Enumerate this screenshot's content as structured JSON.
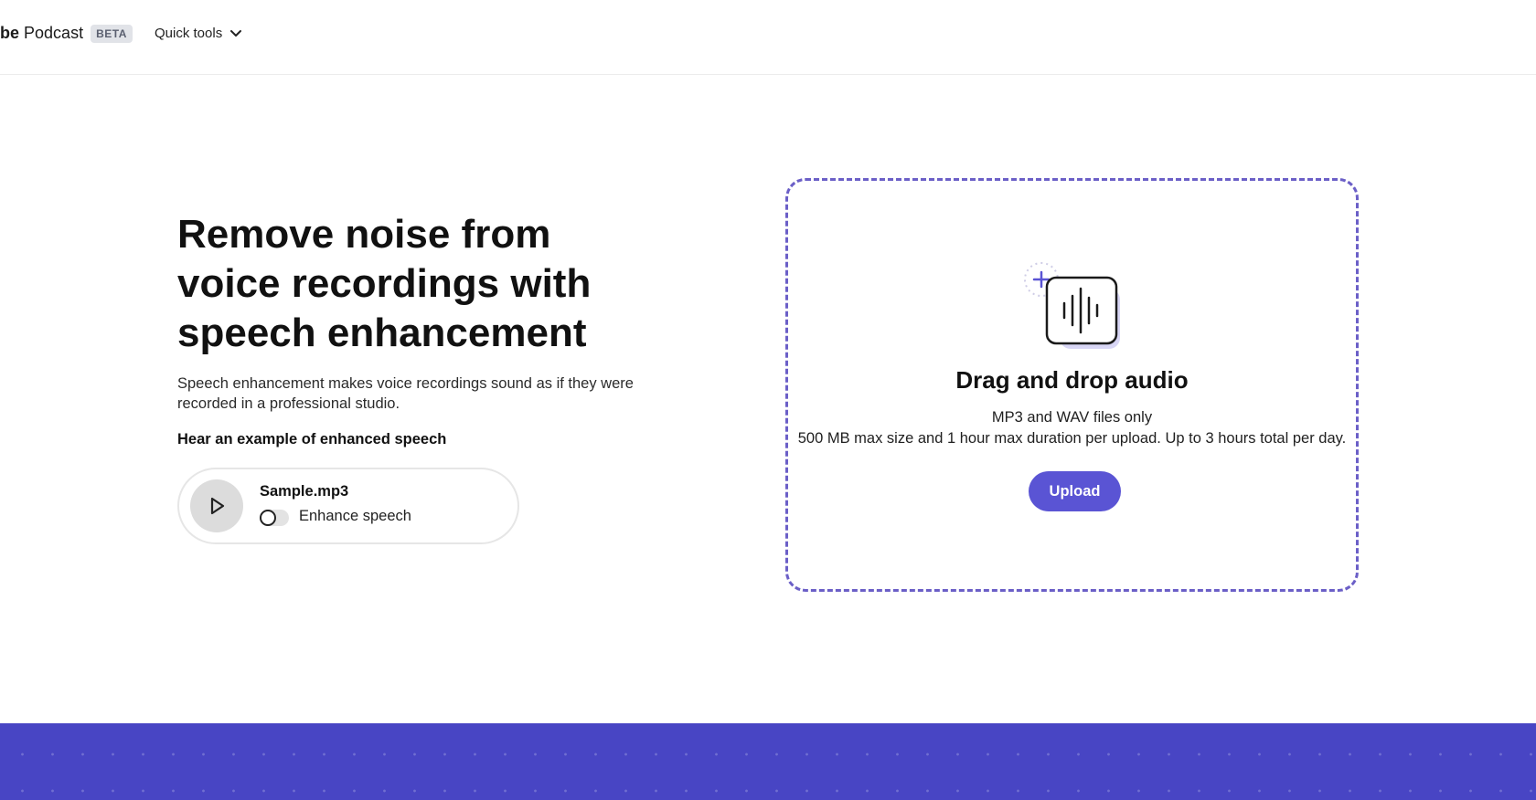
{
  "header": {
    "brand_prefix": "be",
    "brand_name": "Podcast",
    "badge": "BETA",
    "quick_tools_label": "Quick tools"
  },
  "hero": {
    "title": "Remove noise from voice recordings with speech enhancement",
    "description": "Speech enhancement makes voice recordings sound as if they were recorded in a professional studio.",
    "example_label": "Hear an example of enhanced speech"
  },
  "sample": {
    "file_name": "Sample.mp3",
    "toggle_label": "Enhance speech",
    "toggle_on": false
  },
  "dropzone": {
    "title": "Drag and drop audio",
    "formats": "MP3 and WAV files only",
    "limits": "500 MB max size and 1 hour max duration per upload. Up to 3 hours total per day.",
    "upload_label": "Upload"
  },
  "colors": {
    "accent": "#5a54d4",
    "dashed_border": "#6b5fc7",
    "footer_band": "#4845c4"
  },
  "icons": {
    "quick_tools": "chevron-down-icon",
    "play": "play-icon",
    "upload_graphic": "audio-file-plus-icon"
  }
}
